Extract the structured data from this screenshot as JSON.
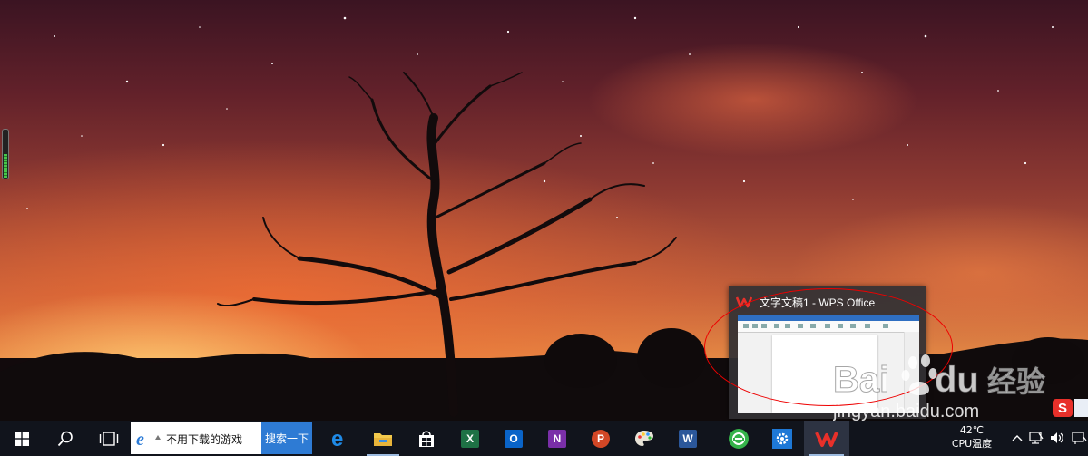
{
  "preview": {
    "title": "文字文稿1 - WPS Office"
  },
  "watermark": {
    "brand": "Baidu",
    "suffix": "经验",
    "url": "jingyan.baidu.com"
  },
  "taskbar": {
    "search_text": "不用下载的游戏",
    "search_button": "搜索一下",
    "apps": [
      {
        "name": "edge-app",
        "icon": "edge-icon"
      },
      {
        "name": "file-explorer-app",
        "icon": "folder-icon"
      },
      {
        "name": "store-app",
        "icon": "store-icon"
      },
      {
        "name": "excel-app",
        "icon": "excel-icon",
        "letter": "X"
      },
      {
        "name": "outlook-app",
        "icon": "outlook-icon",
        "letter": "O"
      },
      {
        "name": "onenote-app",
        "icon": "onenote-icon",
        "letter": "N"
      },
      {
        "name": "powerpoint-app",
        "icon": "powerpoint-icon",
        "letter": "P"
      },
      {
        "name": "paint-app",
        "icon": "palette-icon"
      },
      {
        "name": "word-app",
        "icon": "word-icon",
        "letter": "W"
      },
      {
        "name": "360-app",
        "icon": "refresh-icon"
      },
      {
        "name": "settings-app",
        "icon": "gear-icon"
      },
      {
        "name": "wps-app",
        "icon": "wps-icon",
        "active": true
      }
    ],
    "tray": {
      "temperature": "42℃",
      "temperature_label": "CPU温度",
      "ime_char": "S"
    }
  },
  "colors": {
    "taskbar": "#11141c",
    "search_button": "#2e7bd4",
    "annotation": "#e00000",
    "wps_red": "#e8302a"
  }
}
